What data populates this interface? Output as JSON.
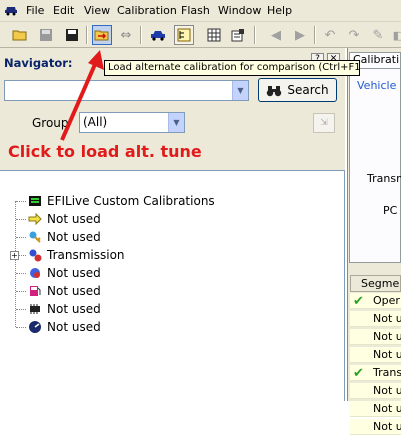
{
  "menubar": {
    "items": [
      "File",
      "Edit",
      "View",
      "Calibration",
      "Flash",
      "Window",
      "Help"
    ]
  },
  "tooltip": "Load alternate calibration for comparison (Ctrl+F11)",
  "navigator": {
    "title": "Navigator:",
    "search_value": "",
    "search_button": "Search",
    "group_label": "Group",
    "group_value": "(All)"
  },
  "annotation": {
    "text": "Click to load alt. tune",
    "color": "#e11b1b"
  },
  "tree": {
    "items": [
      {
        "label": "EFILive Custom Calibrations",
        "icon": "custom-calibrations-icon"
      },
      {
        "label": "Not used",
        "icon": "arrow-tag-icon"
      },
      {
        "label": "Not used",
        "icon": "key-icon"
      },
      {
        "label": "Transmission",
        "icon": "gears-icon",
        "expandable": true
      },
      {
        "label": "Not used",
        "icon": "gear-icon"
      },
      {
        "label": "Not used",
        "icon": "fuel-pump-icon"
      },
      {
        "label": "Not used",
        "icon": "chip-icon"
      },
      {
        "label": "Not used",
        "icon": "gauge-icon"
      }
    ]
  },
  "calibration_pane": {
    "tab": "Calibrati",
    "vehicle": "Vehicle",
    "trans": "Transm",
    "pc": "PC",
    "segments_header": "Segme",
    "segments": [
      {
        "label": "Oper",
        "checked": true
      },
      {
        "label": "Not u",
        "checked": false
      },
      {
        "label": "Not u",
        "checked": false
      },
      {
        "label": "Not u",
        "checked": false
      },
      {
        "label": "Trans",
        "checked": true
      },
      {
        "label": "Not u",
        "checked": false
      },
      {
        "label": "Not u",
        "checked": false
      },
      {
        "label": "Not u",
        "checked": false
      }
    ]
  }
}
